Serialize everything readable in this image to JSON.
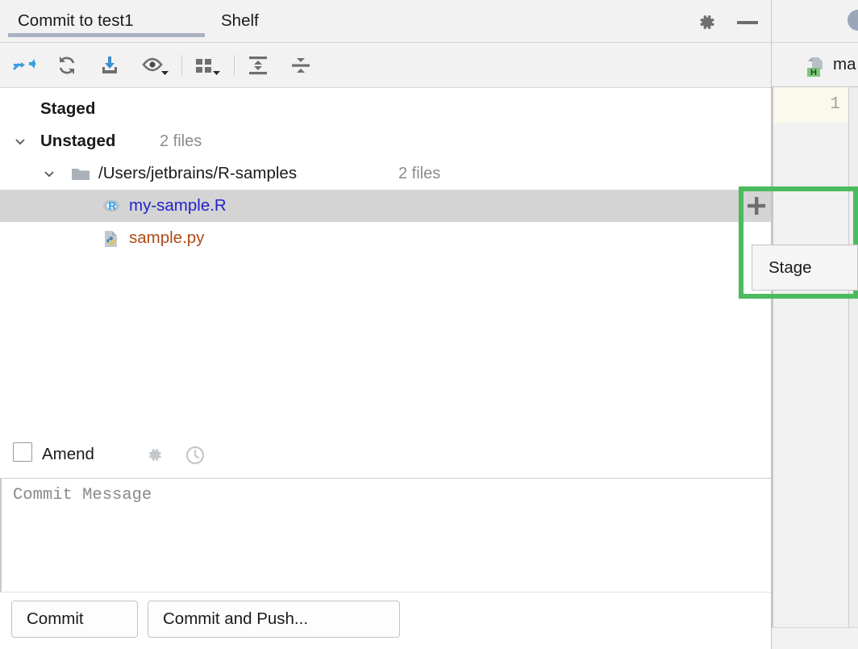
{
  "window": {
    "tabs": [
      {
        "label": "Commit to test1",
        "active": true
      },
      {
        "label": "Shelf",
        "active": false
      }
    ],
    "gear_icon": "gear-icon",
    "minimize_icon": "minimize-icon"
  },
  "toolbar": {
    "buttons": [
      {
        "name": "collapse-arrows-icon",
        "label": "Collapse Arrows"
      },
      {
        "name": "refresh-icon",
        "label": "Refresh Changes"
      },
      {
        "name": "revert-download-icon",
        "label": "Rollback"
      },
      {
        "name": "eye-icon",
        "label": "Show Diff Preview"
      },
      {
        "name": "group-by-icon",
        "label": "Group By"
      },
      {
        "name": "expand-all-icon",
        "label": "Expand All"
      },
      {
        "name": "collapse-all-icon",
        "label": "Collapse All"
      }
    ]
  },
  "tree": {
    "nodes": [
      {
        "name": "staged-node",
        "label": "Staged",
        "count": "",
        "expandable": false,
        "indent": 50
      },
      {
        "name": "unstaged-node",
        "label": "Unstaged",
        "count": "2 files",
        "expandable": true,
        "expanded": true,
        "indent": 50
      },
      {
        "name": "directory-node",
        "label": "/Users/jetbrains/R-samples",
        "count": "2 files",
        "expandable": true,
        "expanded": true,
        "indent": 122,
        "icon": "folder-icon"
      },
      {
        "name": "file-node-r",
        "label": "my-sample.R",
        "count": "",
        "indent": 162,
        "icon": "r-file-icon",
        "selected": true
      },
      {
        "name": "file-node-py",
        "label": "sample.py",
        "count": "",
        "indent": 162,
        "icon": "python-file-icon",
        "selected": false
      }
    ]
  },
  "stage_action": {
    "plus_icon": "plus-icon",
    "tooltip_label": "Stage",
    "highlight_color": "#4cbb5e"
  },
  "amend": {
    "label": "Amend",
    "checked": false,
    "gear_icon": "gear-icon",
    "history_icon": "clock-icon"
  },
  "commit_message": {
    "value": "",
    "placeholder": "Commit Message"
  },
  "actions": {
    "commit_label": "Commit",
    "commit_push_label": "Commit and Push..."
  },
  "editor": {
    "file_badge": "H",
    "filename": "ma",
    "line_number": "1",
    "circle_icon": "avatar-icon"
  }
}
